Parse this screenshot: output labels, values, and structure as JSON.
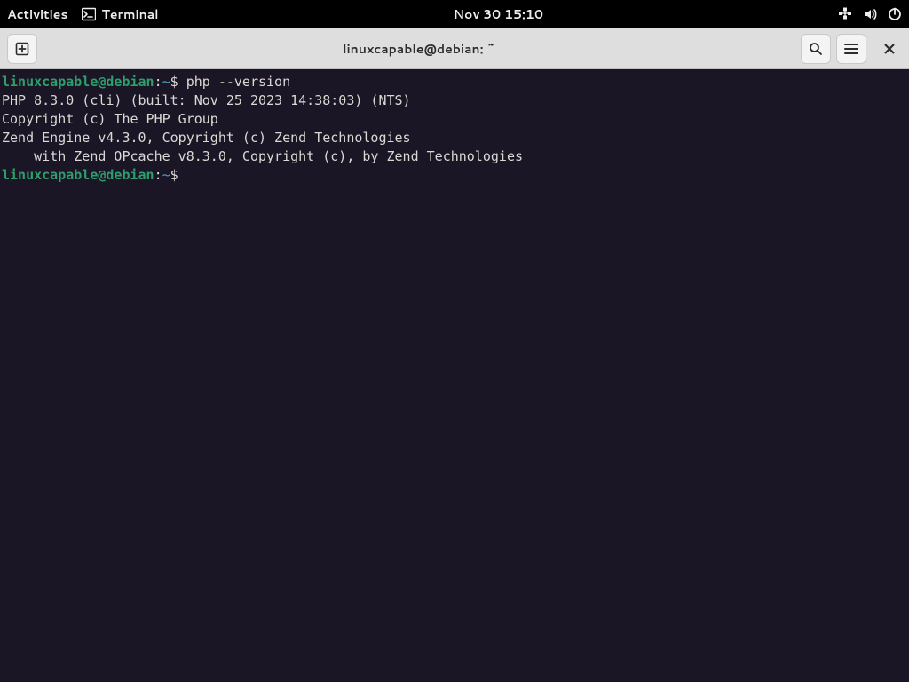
{
  "topbar": {
    "activities_label": "Activities",
    "app_name": "Terminal",
    "datetime": "Nov 30  15:10"
  },
  "headerbar": {
    "title": "linuxcapable@debian: ~"
  },
  "terminal": {
    "prompt": {
      "user_host": "linuxcapable@debian",
      "colon": ":",
      "path": "~",
      "dollar": "$"
    },
    "command1": " php --version",
    "output_lines": [
      "PHP 8.3.0 (cli) (built: Nov 25 2023 14:38:03) (NTS)",
      "Copyright (c) The PHP Group",
      "Zend Engine v4.3.0, Copyright (c) Zend Technologies",
      "    with Zend OPcache v8.3.0, Copyright (c), by Zend Technologies"
    ],
    "command2": " "
  }
}
